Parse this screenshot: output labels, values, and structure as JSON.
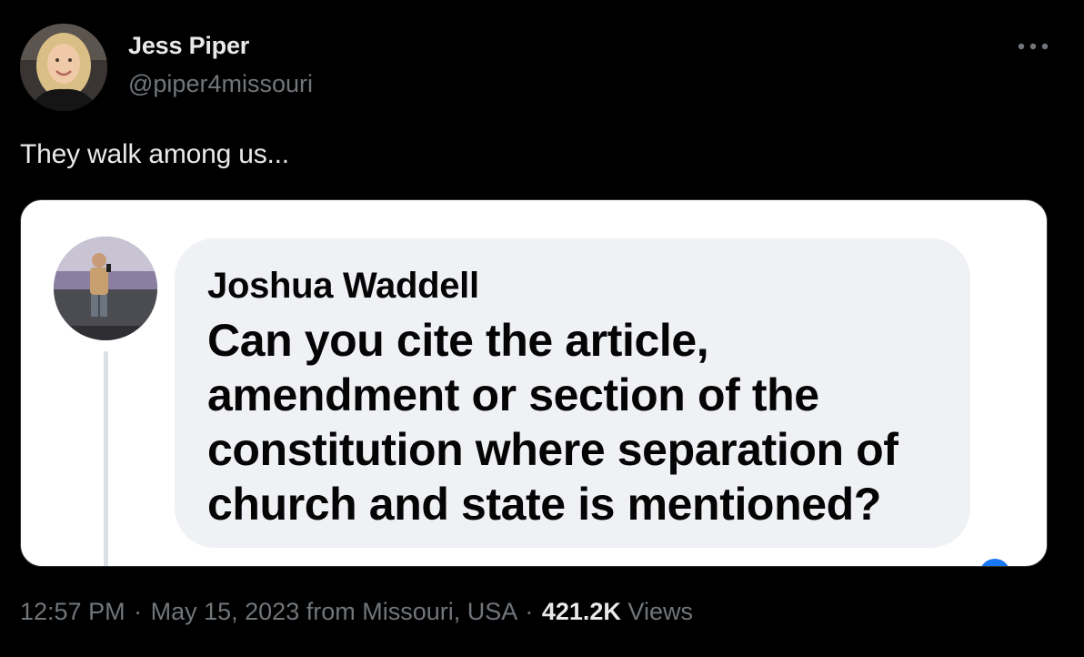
{
  "author": {
    "name": "Jess Piper",
    "handle": "@piper4missouri"
  },
  "tweet": {
    "text": "They walk among us..."
  },
  "embedded_comment": {
    "name": "Joshua Waddell",
    "text": "Can you cite the article, amendment or section of the constitution where separation of church and state is mentioned?"
  },
  "meta": {
    "time": "12:57 PM",
    "separator": "·",
    "date": "May 15, 2023",
    "from_prefix": "from",
    "location": "Missouri, USA",
    "views_count": "421.2K",
    "views_label": "Views"
  },
  "colors": {
    "background": "#000000",
    "primary_text": "#e7e9ea",
    "secondary_text": "#71767b",
    "card_background": "#ffffff",
    "bubble_background": "#f0f1f4",
    "facebook_blue": "#1877f2"
  },
  "icons": {
    "more": "more-horizontal-icon",
    "profile": "avatar"
  }
}
